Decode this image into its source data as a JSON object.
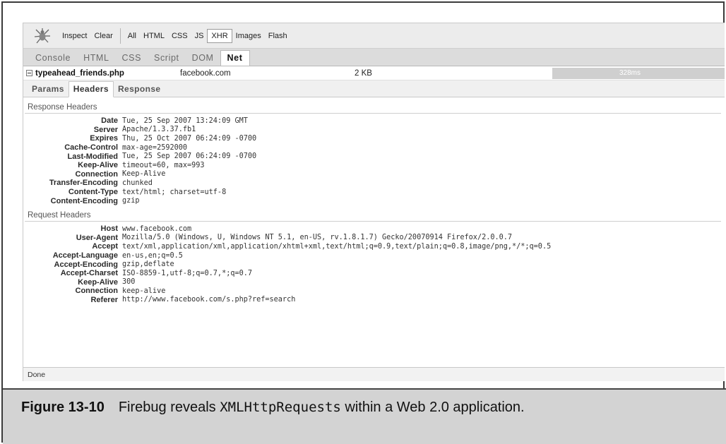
{
  "toolbar": {
    "inspect": "Inspect",
    "clear": "Clear",
    "filters": [
      "All",
      "HTML",
      "CSS",
      "JS",
      "XHR",
      "Images",
      "Flash"
    ],
    "selected_filter": "XHR"
  },
  "panel_tabs": [
    "Console",
    "HTML",
    "CSS",
    "Script",
    "DOM",
    "Net"
  ],
  "active_panel": "Net",
  "request": {
    "name": "typeahead_friends.php",
    "domain": "facebook.com",
    "size": "2 KB",
    "time": "328ms"
  },
  "detail_tabs": [
    "Params",
    "Headers",
    "Response"
  ],
  "active_detail_tab": "Headers",
  "response_headers_title": "Response Headers",
  "response_headers": [
    {
      "name": "Date",
      "value": "Tue, 25 Sep 2007 13:24:09 GMT"
    },
    {
      "name": "Server",
      "value": "Apache/1.3.37.fb1"
    },
    {
      "name": "Expires",
      "value": "Thu, 25 Oct 2007 06:24:09 -0700"
    },
    {
      "name": "Cache-Control",
      "value": "max-age=2592000"
    },
    {
      "name": "Last-Modified",
      "value": "Tue, 25 Sep 2007 06:24:09 -0700"
    },
    {
      "name": "Keep-Alive",
      "value": "timeout=60, max=993"
    },
    {
      "name": "Connection",
      "value": "Keep-Alive"
    },
    {
      "name": "Transfer-Encoding",
      "value": "chunked"
    },
    {
      "name": "Content-Type",
      "value": "text/html; charset=utf-8"
    },
    {
      "name": "Content-Encoding",
      "value": "gzip"
    }
  ],
  "request_headers_title": "Request Headers",
  "request_headers": [
    {
      "name": "Host",
      "value": "www.facebook.com"
    },
    {
      "name": "User-Agent",
      "value": "Mozilla/5.0 (Windows, U, Windows NT 5.1, en-US, rv.1.8.1.7) Gecko/20070914 Firefox/2.0.0.7"
    },
    {
      "name": "Accept",
      "value": "text/xml,application/xml,application/xhtml+xml,text/html;q=0.9,text/plain;q=0.8,image/png,*/*;q=0.5"
    },
    {
      "name": "Accept-Language",
      "value": "en-us,en;q=0.5"
    },
    {
      "name": "Accept-Encoding",
      "value": "gzip,deflate"
    },
    {
      "name": "Accept-Charset",
      "value": "ISO-8859-1,utf-8;q=0.7,*;q=0.7"
    },
    {
      "name": "Keep-Alive",
      "value": "300"
    },
    {
      "name": "Connection",
      "value": "keep-alive"
    },
    {
      "name": "Referer",
      "value": "http://www.facebook.com/s.php?ref=search"
    }
  ],
  "status": "Done",
  "caption": {
    "label": "Figure 13-10",
    "text_before": "Firebug reveals ",
    "code": "XMLHttpRequests",
    "text_after": " within a Web 2.0 application."
  }
}
